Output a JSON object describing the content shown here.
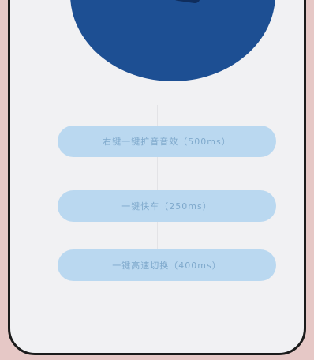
{
  "actions": {
    "items": [
      {
        "label": "右键一键扩音音效（500ms）"
      },
      {
        "label": "一键快车（250ms）"
      },
      {
        "label": "一键高速切换（400ms）"
      }
    ]
  }
}
